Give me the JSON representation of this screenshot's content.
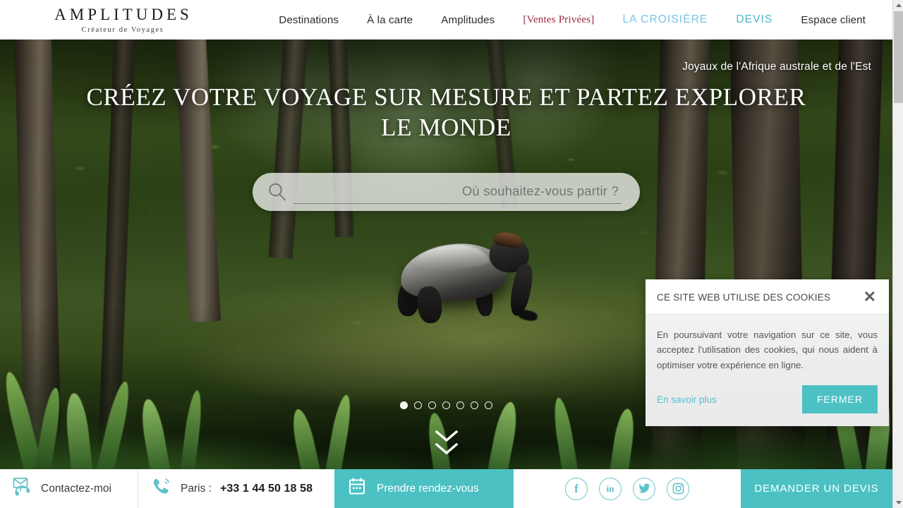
{
  "header": {
    "logo": {
      "name": "AMPLITUDES",
      "tagline": "Créateur de Voyages"
    },
    "nav": [
      {
        "label": "Destinations",
        "style": "plain"
      },
      {
        "label": "À la carte",
        "style": "plain"
      },
      {
        "label": "Amplitudes",
        "style": "plain"
      },
      {
        "label": "[Ventes Privées]",
        "style": "vp"
      },
      {
        "label": "LA CROISIÈRE",
        "style": "croisiere"
      },
      {
        "label": "DEVIS",
        "style": "devis"
      },
      {
        "label": "Espace client",
        "style": "plain"
      }
    ]
  },
  "hero": {
    "caption": "Joyaux de l'Afrique australe et de l'Est",
    "title": "CRÉEZ VOTRE VOYAGE SUR MESURE ET PARTEZ EXPLORER LE MONDE",
    "search": {
      "placeholder": "Où souhaitez-vous partir ?",
      "value": "",
      "icon": "search-icon"
    },
    "carousel": {
      "total": 7,
      "active_index": 0
    },
    "scroll_hint_icon": "double-chevron-down-icon"
  },
  "cookie_banner": {
    "title": "CE SITE WEB UTILISE DES COOKIES",
    "close_icon": "close-icon",
    "body": "En poursuivant votre navigation sur ce site, vous acceptez l'utilisation des cookies, qui nous aident à optimiser votre expérience en ligne.",
    "link_label": "En savoir plus",
    "button_label": "FERMER"
  },
  "footer": {
    "contact_label": "Contactez-moi",
    "contact_icon": "mail-headset-icon",
    "phone_label": "Paris :",
    "phone_number": "+33 1 44 50 18 58",
    "phone_icon": "phone-icon",
    "appointment_label": "Prendre rendez-vous",
    "appointment_icon": "calendar-icon",
    "social": [
      {
        "name": "facebook-icon",
        "glyph": "f"
      },
      {
        "name": "linkedin-icon",
        "glyph": "in"
      },
      {
        "name": "twitter-icon",
        "glyph": "twitter"
      },
      {
        "name": "instagram-icon",
        "glyph": "instagram"
      }
    ],
    "quote_button_label": "DEMANDER UN DEVIS"
  },
  "colors": {
    "teal": "#4cc1c4",
    "sky": "#79c2e6",
    "red": "#9c2639",
    "link": "#57c0ce"
  }
}
